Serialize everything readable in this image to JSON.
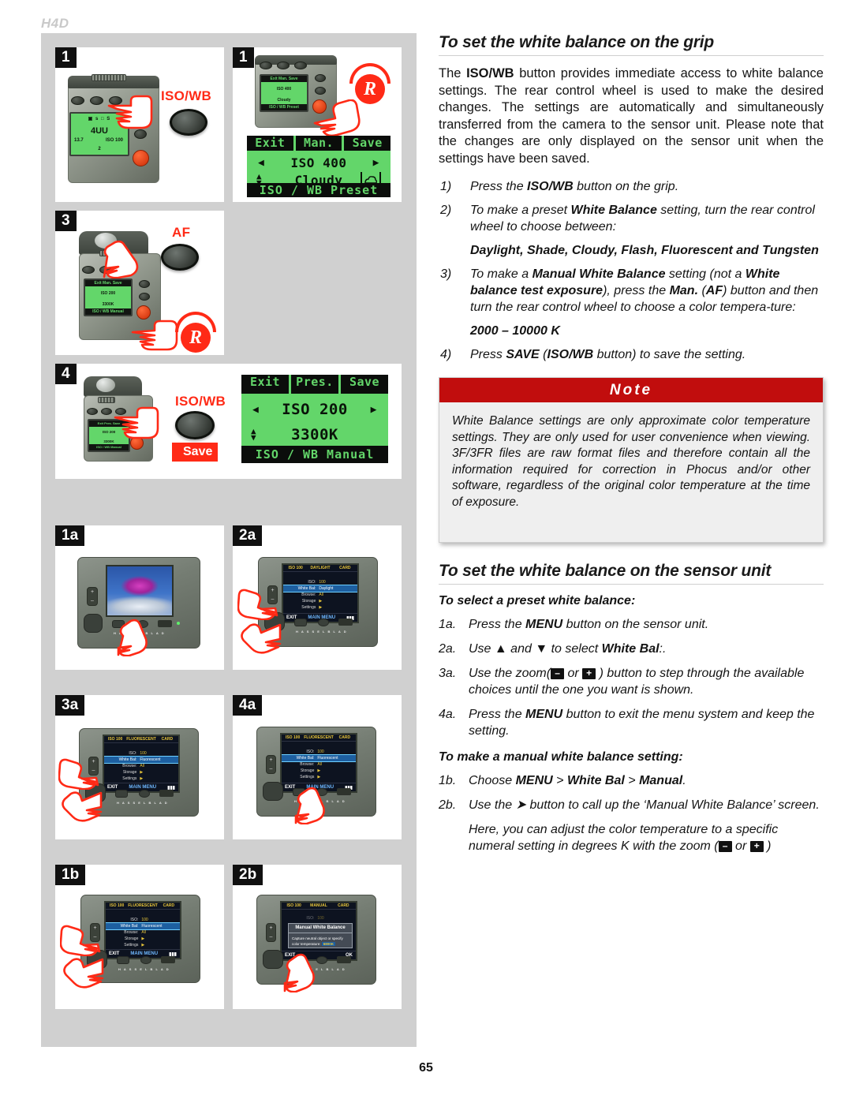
{
  "header": {
    "model": "H4D"
  },
  "page": {
    "number": "65"
  },
  "left_column": {
    "panels": [
      {
        "badge": "1",
        "callout_label": "ISO/WB",
        "icons": [
          "pointing-hand-icon",
          "iso-wb-button-icon"
        ],
        "lcd": {
          "line1": "4UU",
          "line2_left": "13.7",
          "line2_right": "ISO 100",
          "line3": "2"
        }
      },
      {
        "badge": "1",
        "icons": [
          "pointing-hand-icon",
          "rear-wheel-r-icon"
        ],
        "lcd": {
          "top_tabs": [
            "Exit",
            "Man.",
            "Save"
          ],
          "row1": "ISO 400",
          "row2": "Cloudy",
          "row2_icon": "cloud-icon",
          "bottom": "ISO / WB Preset"
        }
      },
      {
        "badge": "3",
        "callout_label": "AF",
        "icons": [
          "pointing-hand-icon",
          "af-button-icon",
          "rear-wheel-r-icon"
        ],
        "lcd": {
          "row1": "ISO 200",
          "row2": "3300K",
          "bottom": "ISO / WB Manual"
        }
      },
      {
        "badge": "4",
        "callout_label": "ISO/WB",
        "save_badge": "Save",
        "icons": [
          "pointing-hand-icon",
          "iso-wb-button-icon"
        ],
        "lcd": {
          "top_tabs": [
            "Exit",
            "Pres.",
            "Save"
          ],
          "row1": "ISO 200",
          "row2": "3300K",
          "bottom": "ISO / WB Manual"
        }
      },
      {
        "badge": "1a",
        "icons": [
          "pointing-hand-icon",
          "flower-thumbnail-icon"
        ],
        "screen": {
          "mode": "image-preview"
        }
      },
      {
        "badge": "2a",
        "icons": [
          "pointing-hand-icon"
        ],
        "screen": {
          "topbar": [
            "ISO 100",
            "DAYLIGHT",
            "CARD"
          ],
          "rows": [
            {
              "key": "ISO:",
              "value": "100",
              "selected": false
            },
            {
              "key": "White Bal:",
              "value": "Daylight",
              "selected": true
            },
            {
              "key": "Browse:",
              "value": "All",
              "selected": false
            },
            {
              "key": "Storage",
              "value": "▶",
              "selected": false
            },
            {
              "key": "Settings",
              "value": "▶",
              "selected": false
            }
          ],
          "bottom_left": "EXIT",
          "bottom_mid": "MAIN MENU"
        }
      },
      {
        "badge": "3a",
        "icons": [
          "pointing-hand-icon"
        ],
        "screen": {
          "topbar": [
            "ISO 100",
            "FLUORESCENT",
            "CARD"
          ],
          "rows": [
            {
              "key": "ISO:",
              "value": "100",
              "selected": false
            },
            {
              "key": "White Bal:",
              "value": "Fluorescent",
              "selected": true
            },
            {
              "key": "Browse:",
              "value": "All",
              "selected": false
            },
            {
              "key": "Storage",
              "value": "▶",
              "selected": false
            },
            {
              "key": "Settings",
              "value": "▶",
              "selected": false
            }
          ],
          "bottom_left": "EXIT",
          "bottom_mid": "MAIN MENU"
        }
      },
      {
        "badge": "4a",
        "icons": [
          "pointing-hand-icon"
        ],
        "screen": {
          "topbar": [
            "ISO 100",
            "FLUORESCENT",
            "CARD"
          ],
          "rows": [
            {
              "key": "ISO:",
              "value": "100",
              "selected": false
            },
            {
              "key": "White Bal:",
              "value": "Fluorescent",
              "selected": true
            },
            {
              "key": "Browse:",
              "value": "All",
              "selected": false
            },
            {
              "key": "Storage",
              "value": "▶",
              "selected": false
            },
            {
              "key": "Settings",
              "value": "▶",
              "selected": false
            }
          ],
          "bottom_left": "EXIT",
          "bottom_mid": "MAIN MENU"
        }
      },
      {
        "badge": "1b",
        "icons": [
          "pointing-hand-icon"
        ],
        "screen": {
          "topbar": [
            "ISO 100",
            "FLUORESCENT",
            "CARD"
          ],
          "rows": [
            {
              "key": "ISO:",
              "value": "100",
              "selected": false
            },
            {
              "key": "White Bal:",
              "value": "Fluorescent",
              "selected": true
            },
            {
              "key": "Browse:",
              "value": "All",
              "selected": false
            },
            {
              "key": "Storage",
              "value": "▶",
              "selected": false
            },
            {
              "key": "Settings",
              "value": "▶",
              "selected": false
            }
          ],
          "bottom_left": "EXIT",
          "bottom_mid": "MAIN MENU"
        }
      },
      {
        "badge": "2b",
        "icons": [
          "pointing-hand-icon"
        ],
        "screen": {
          "topbar": [
            "ISO 100",
            "MANUAL",
            "CARD"
          ],
          "dim_row": {
            "key": "ISO:",
            "value": "100"
          },
          "dialog": {
            "title": "Manual White Balance",
            "body": "Capture neutral object or specify color temperature:",
            "value": "6800K"
          },
          "bottom_left": "EXIT",
          "bottom_right": "OK"
        }
      }
    ]
  },
  "right_column": {
    "section1": {
      "heading": "To set the white balance on the grip",
      "intro_html": "The <b>ISO/WB</b> button provides immediate access to white balance settings. The rear control wheel is used to make the desired changes. The settings are automatically and simultaneously transferred from the camera to the sensor unit. Please note that the changes are only displayed on the sensor unit when the settings have been saved.",
      "steps": [
        {
          "num": "1)",
          "html": "Press the <b>ISO/WB</b> button on the grip."
        },
        {
          "num": "2)",
          "html": "To make a preset <b>White Balance</b> setting, turn the rear control wheel to choose between:"
        }
      ],
      "presets_line": "Daylight, Shade, Cloudy, Flash, Fluorescent and Tungsten",
      "steps2": [
        {
          "num": "3)",
          "html": "To make a <b>Manual White Balance</b> setting (not a <b>White balance test exposure</b>), press the <b>Man.</b> (<b>AF</b>) button and then turn the rear control wheel to choose a color tempera-ture:"
        }
      ],
      "range_line": "2000 – 10000 K",
      "steps3": [
        {
          "num": "4)",
          "html": "Press <b>SAVE</b> (<b>ISO/WB</b> button) to save the setting."
        }
      ]
    },
    "note": {
      "title": "Note",
      "text": "White Balance settings are only approximate color temperature settings. They are only used for user convenience when viewing. 3F/3FR files are raw format files and therefore contain all the information required for correction in Phocus and/or other software, regardless of the original color temperature at the time of exposure."
    },
    "section2": {
      "heading": "To set the white balance on the sensor unit",
      "sub_head_1": "To select a preset white balance:",
      "steps_a": [
        {
          "num": "1a.",
          "html": "Press the <b>MENU</b> button on the sensor unit."
        },
        {
          "num": "2a.",
          "html": "Use ▲ and ▼ to select <b>White Bal</b>:."
        },
        {
          "num": "3a.",
          "html": "Use the zoom(<span class=\"zoom-key\">–</span> or <span class=\"zoom-key\">+</span> ) button to step through the available choices until the one you want is shown."
        },
        {
          "num": "4a.",
          "html": "Press the <b>MENU</b> button to exit the menu system and keep the setting."
        }
      ],
      "sub_head_2": "To make a manual white balance setting:",
      "steps_b": [
        {
          "num": "1b.",
          "html": "Choose <b>MENU</b> > <b>White Bal</b> > <b>Manual</b>."
        },
        {
          "num": "2b.",
          "html": "Use the ➤ button to call up the ‘Manual White Balance’ screen."
        },
        {
          "num": "",
          "html": "Here, you can adjust the color temperature to a specific numeral setting in degrees K with the zoom (<span class=\"zoom-key\">–</span> or <span class=\"zoom-key\">+</span> )"
        }
      ]
    }
  },
  "colors": {
    "note_red": "#c10d0d",
    "callout_red": "#ff2a16",
    "lcd_green": "#63d66a",
    "panel_gray": "#d0d0d0",
    "badge_black": "#101010"
  }
}
